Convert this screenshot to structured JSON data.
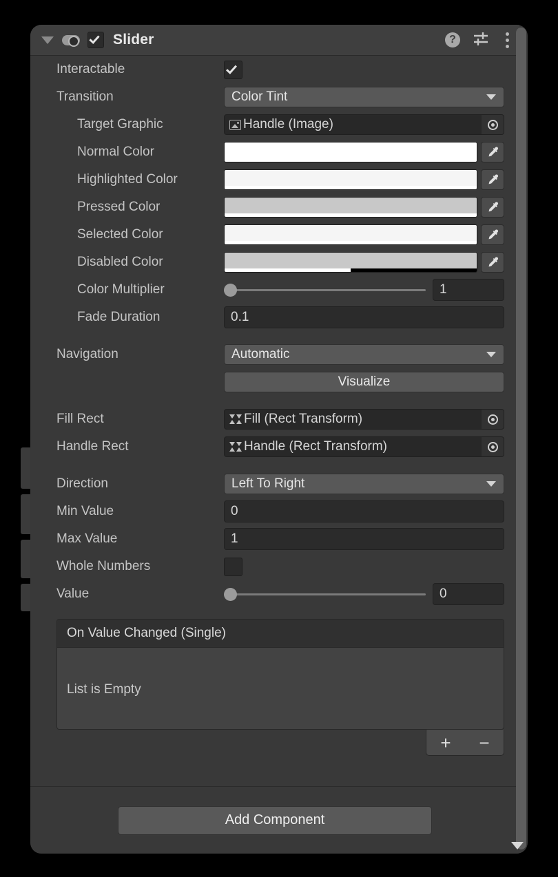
{
  "panel": {
    "header": {
      "title": "Slider",
      "foldout_icon": "triangle-down-icon",
      "visibility_icon": "eye-toggle-icon",
      "enabled_checkbox": true,
      "help_icon": "help-icon",
      "help_glyph": "?",
      "preset_icon": "preset-sliders-icon",
      "menu_icon": "kebab-menu-icon"
    },
    "rows": {
      "interactable": {
        "label": "Interactable",
        "checked": true
      },
      "transition": {
        "label": "Transition",
        "value": "Color Tint"
      },
      "target_graphic": {
        "label": "Target Graphic",
        "value": "Handle (Image)",
        "icon": "image-sprite-icon"
      },
      "normal_color": {
        "label": "Normal Color",
        "color": "#FFFFFF",
        "alpha": 100
      },
      "highlighted_color": {
        "label": "Highlighted Color",
        "color": "#F5F5F5",
        "alpha": 100
      },
      "pressed_color": {
        "label": "Pressed Color",
        "color": "#C8C8C8",
        "alpha": 100
      },
      "selected_color": {
        "label": "Selected Color",
        "color": "#F5F5F5",
        "alpha": 100
      },
      "disabled_color": {
        "label": "Disabled Color",
        "color": "#C8C8C8",
        "alpha": 50
      },
      "color_multiplier": {
        "label": "Color Multiplier",
        "value": "1",
        "slider_percent": 0
      },
      "fade_duration": {
        "label": "Fade Duration",
        "value": "0.1"
      },
      "navigation": {
        "label": "Navigation",
        "value": "Automatic"
      },
      "visualize": {
        "label": "Visualize"
      },
      "fill_rect": {
        "label": "Fill Rect",
        "value": "Fill (Rect Transform)",
        "icon": "rect-transform-icon"
      },
      "handle_rect": {
        "label": "Handle Rect",
        "value": "Handle (Rect Transform)",
        "icon": "rect-transform-icon"
      },
      "direction": {
        "label": "Direction",
        "value": "Left To Right"
      },
      "min_value": {
        "label": "Min Value",
        "value": "0"
      },
      "max_value": {
        "label": "Max Value",
        "value": "1"
      },
      "whole_numbers": {
        "label": "Whole Numbers",
        "checked": false
      },
      "value": {
        "label": "Value",
        "value": "0",
        "slider_percent": 0
      }
    },
    "event_list": {
      "title": "On Value Changed (Single)",
      "empty_text": "List is Empty",
      "add_label": "+",
      "remove_label": "−"
    },
    "footer": {
      "add_component_label": "Add Component"
    }
  }
}
